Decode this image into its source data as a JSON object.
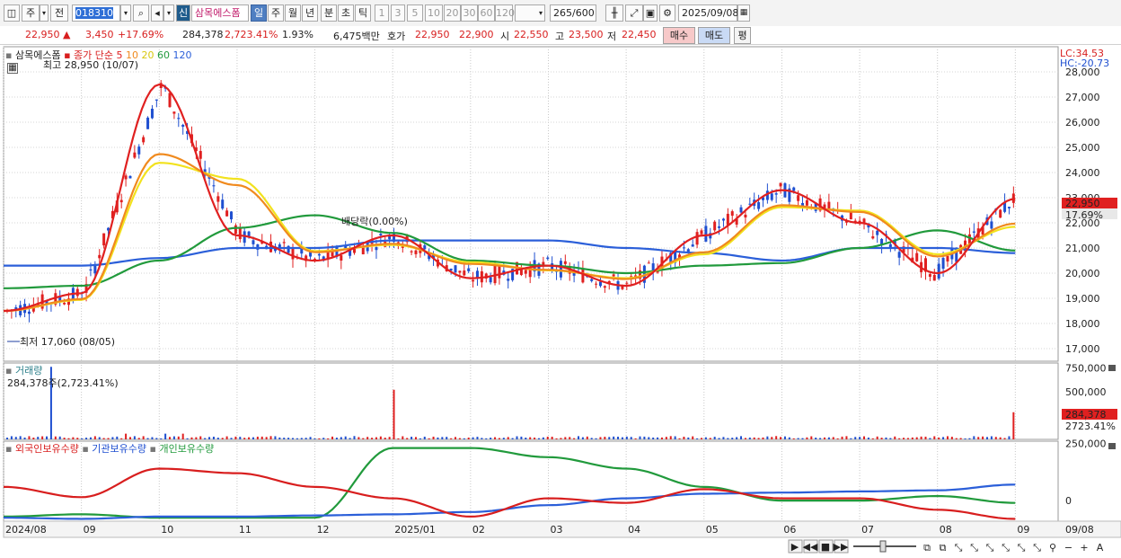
{
  "toolbar": {
    "market": "주",
    "prev": "전",
    "code": "018310",
    "new_badge": "신",
    "stock_name": "삼목에스폼",
    "periods": [
      "일",
      "주",
      "월",
      "년",
      "분",
      "초",
      "틱"
    ],
    "active_period": "일",
    "intervals": [
      "1",
      "3",
      "5",
      "10",
      "20",
      "30",
      "60",
      "120"
    ],
    "count": "265",
    "count_total": "/600",
    "date": "2025/09/08"
  },
  "quote": {
    "price": "22,950",
    "change": "3,450",
    "change_pct": "+17.69%",
    "volume": "284,378",
    "volume_ratio": "2,723.41%",
    "turnover": "1.93%",
    "amount": "6,475백만",
    "bid_label": "호가",
    "ask": "22,950",
    "bid": "22,900",
    "open_label": "시",
    "open": "22,550",
    "high_label": "고",
    "high": "23,500",
    "low_label": "저",
    "low": "22,450",
    "buy_btn": "매수",
    "sell_btn": "매도",
    "eval_btn": "평"
  },
  "price_panel": {
    "legend_name": "삼목에스폼",
    "legend_series": "종가 단순",
    "ma_periods": [
      "5",
      "10",
      "20",
      "60",
      "120"
    ],
    "ma_colors": [
      "#e02020",
      "#f08a1e",
      "#f2e21e",
      "#219a3c",
      "#2b5fd9"
    ],
    "high_annot": "최고 28,950 (10/07)",
    "low_annot": "최저 17,060 (08/05)",
    "event_annot": "배당락(0.00%)",
    "lc": "LC:34.53",
    "hc": "HC:-20.73",
    "last_price_tag": "22,950",
    "last_pct_tag": "17.69%",
    "yticks": [
      "28,000",
      "27,000",
      "26,000",
      "25,000",
      "24,000",
      "23,000",
      "22,000",
      "21,000",
      "20,000",
      "19,000",
      "18,000",
      "17,000"
    ]
  },
  "volume_panel": {
    "title": "거래량",
    "value": "284,378주(2,723.41%)",
    "yticks": [
      "750,000",
      "500,000",
      "250,000"
    ],
    "tag_value": "284,378",
    "tag_pct": "2723.41%"
  },
  "holding_panel": {
    "legend": [
      "외국인보유수량",
      "기관보유수량",
      "개인보유수량"
    ],
    "colors": [
      "#d81e1e",
      "#2b5fd9",
      "#219a3c"
    ],
    "yticks": [
      "250,000",
      "0"
    ]
  },
  "xaxis": {
    "labels": [
      "2024/08",
      "09",
      "10",
      "11",
      "12",
      "2025/01",
      "02",
      "03",
      "04",
      "05",
      "06",
      "07",
      "08",
      "09"
    ],
    "last_label": "09/08"
  },
  "chart_data": {
    "type": "line",
    "title": "삼목에스폼",
    "x": [
      "2024/08",
      "09",
      "10",
      "11",
      "12",
      "2025/01",
      "02",
      "03",
      "04",
      "05",
      "06",
      "07",
      "08",
      "09"
    ],
    "price_range": [
      16500,
      29000
    ],
    "series": [
      {
        "name": "종가",
        "values": [
          18500,
          19200,
          27500,
          21500,
          20500,
          21500,
          19800,
          20300,
          19500,
          21500,
          23300,
          22000,
          20000,
          22950
        ]
      },
      {
        "name": "120",
        "values": [
          20300,
          20300,
          20600,
          21000,
          21000,
          21300,
          21300,
          21300,
          21000,
          20800,
          20500,
          21000,
          21000,
          20800
        ]
      },
      {
        "name": "60",
        "values": [
          19400,
          19500,
          20500,
          21800,
          22300,
          21600,
          20500,
          20300,
          20000,
          20300,
          20400,
          21000,
          21700,
          20900
        ]
      },
      {
        "name": "거래량",
        "values": [
          760000,
          40000,
          60000,
          20000,
          20000,
          520000,
          20000,
          15000,
          15000,
          30000,
          40000,
          25000,
          15000,
          284378
        ]
      },
      {
        "name": "외국인보유수량",
        "values": [
          60000,
          15000,
          140000,
          120000,
          60000,
          10000,
          -70000,
          10000,
          -10000,
          50000,
          10000,
          10000,
          -40000,
          -80000
        ]
      },
      {
        "name": "기관보유수량",
        "values": [
          -75000,
          -80000,
          -70000,
          -70000,
          -65000,
          -60000,
          -50000,
          -20000,
          10000,
          30000,
          35000,
          40000,
          45000,
          70000
        ]
      },
      {
        "name": "개인보유수량",
        "values": [
          -70000,
          -60000,
          -75000,
          -75000,
          -75000,
          230000,
          230000,
          190000,
          140000,
          60000,
          0,
          0,
          20000,
          -10000
        ]
      }
    ]
  }
}
